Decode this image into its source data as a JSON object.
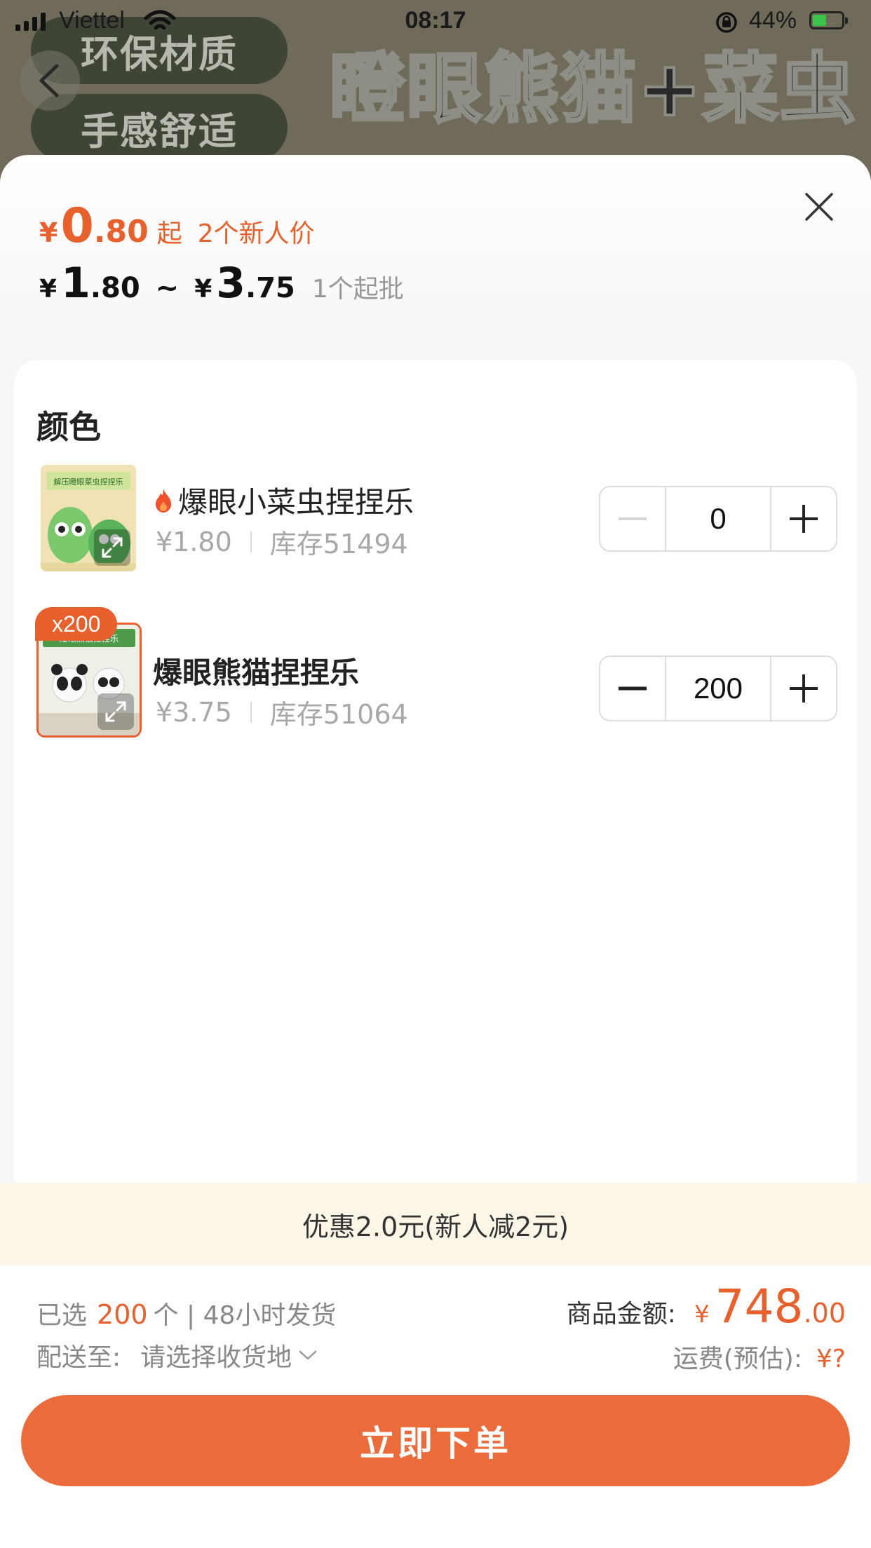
{
  "status_bar": {
    "carrier": "Viettel",
    "time": "08:17",
    "battery": "44%"
  },
  "background_page": {
    "pill_1": "环保材质",
    "pill_2": "手感舒适",
    "title": "瞪眼熊猫+菜虫"
  },
  "sheet": {
    "price_new": {
      "currency": "¥",
      "integer": "0",
      "decimal": ".80",
      "suffix": "起",
      "note": "2个新人价"
    },
    "price_range": {
      "currency": "¥",
      "low_integer": "1",
      "low_decimal": ".80",
      "tilde": "~",
      "high_integer": "3",
      "high_decimal": ".75",
      "min_batch": "1个起批"
    },
    "section_title": "颜色",
    "items": [
      {
        "name": "爆眼小菜虫捏捏乐",
        "price": "¥1.80",
        "stock": "库存51494",
        "quantity": "0",
        "thumb_caption": "解压瞪眼菜虫捏捏乐",
        "hot": true
      },
      {
        "name": "爆眼熊猫捏捏乐",
        "price": "¥3.75",
        "stock": "库存51064",
        "quantity": "200",
        "badge": "x200",
        "thumb_caption": "爆眼熊猫捏捏乐",
        "hot": false
      }
    ]
  },
  "promo": {
    "text": "优惠2.0元(新人减2元)"
  },
  "footer": {
    "selected_prefix": "已选",
    "selected_count": "200",
    "selected_suffix": "个 | 48小时发货",
    "ship_label": "配送至:",
    "ship_placeholder": "请选择收货地",
    "amount_label": "商品金额:",
    "amount_currency": "¥",
    "amount_integer": "748",
    "amount_decimal": ".00",
    "freight_label": "运费(预估):",
    "freight_value": "¥?",
    "order_button": "立即下单"
  },
  "colors": {
    "accent": "#e8602c",
    "button": "#ec6b3a",
    "promo_bg": "#fbf6e8"
  },
  "icons": [
    "back-icon",
    "wifi-icon",
    "lock-rotation-icon",
    "close-icon",
    "fire-icon",
    "expand-icon",
    "minus-icon",
    "plus-icon",
    "chevron-down-icon"
  ]
}
